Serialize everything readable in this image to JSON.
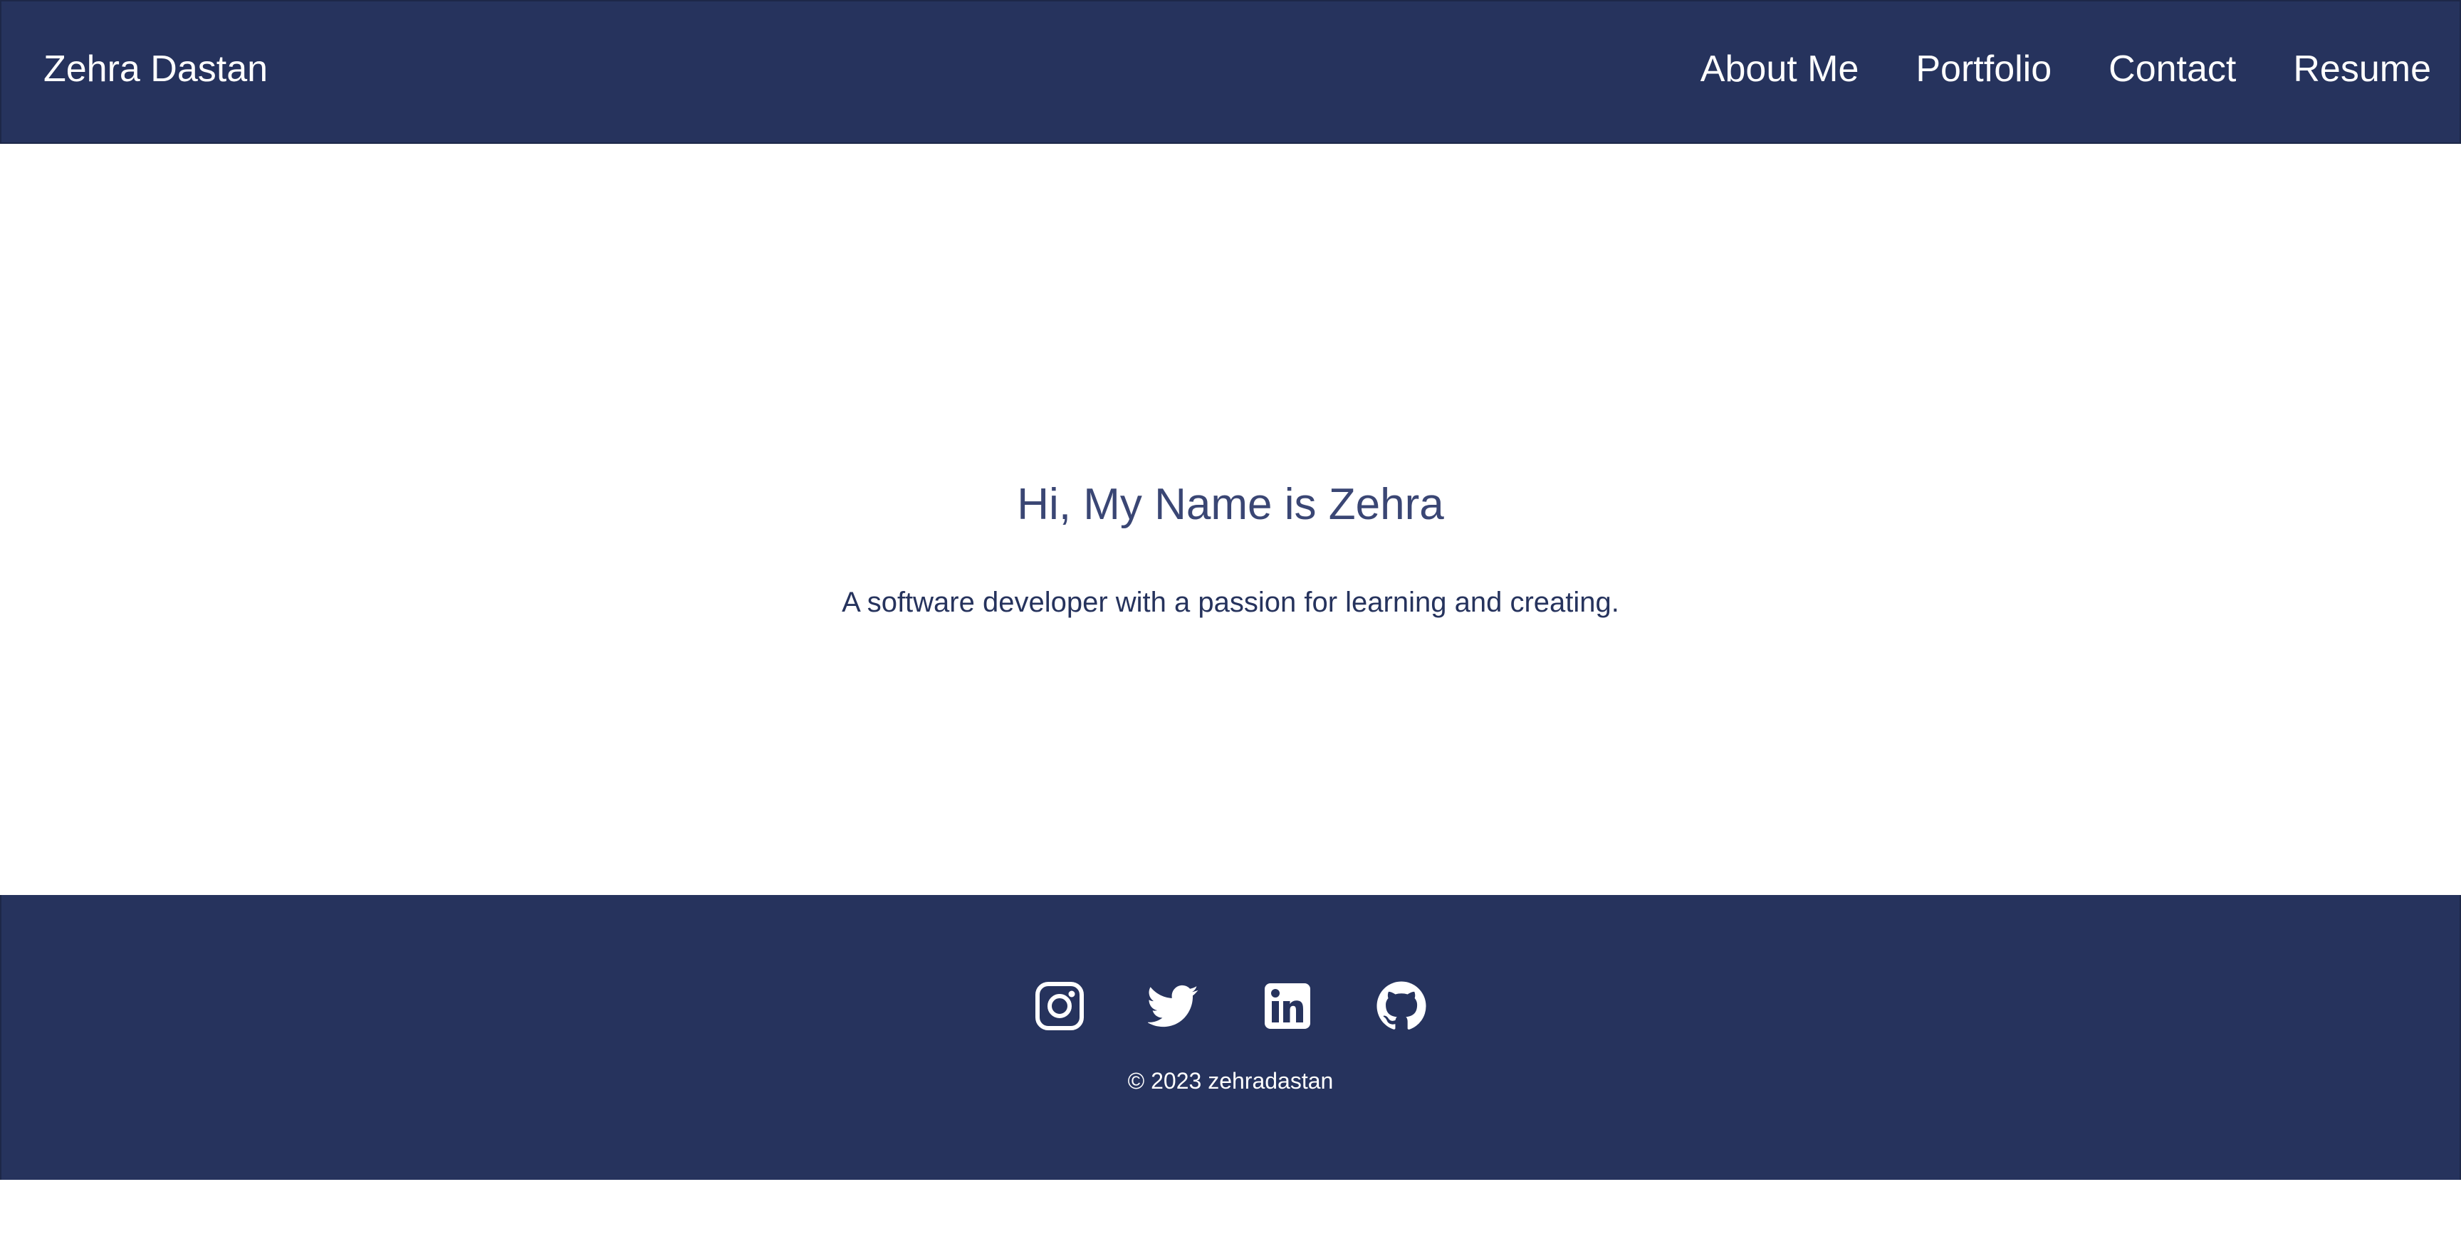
{
  "header": {
    "brand": "Zehra Dastan",
    "nav": [
      {
        "label": "About Me"
      },
      {
        "label": "Portfolio"
      },
      {
        "label": "Contact"
      },
      {
        "label": "Resume"
      }
    ]
  },
  "hero": {
    "title": "Hi, My Name is Zehra",
    "subtitle": "A software developer with a passion for learning and creating."
  },
  "footer": {
    "social": [
      {
        "icon": "instagram-icon"
      },
      {
        "icon": "twitter-icon"
      },
      {
        "icon": "linkedin-icon"
      },
      {
        "icon": "github-icon"
      }
    ],
    "copyright": "© 2023 zehradastan"
  },
  "colors": {
    "navy": "#26335d",
    "title": "#3a4674",
    "white": "#ffffff"
  }
}
